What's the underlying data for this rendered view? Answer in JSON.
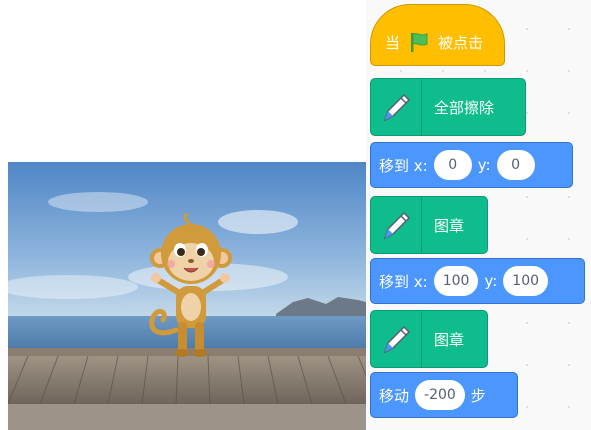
{
  "code": {
    "event_when": "当",
    "event_clicked": "被点击",
    "erase_all": "全部擦除",
    "goto1_label": "移到 x:",
    "goto1_x": "0",
    "goto1_ylabel": "y:",
    "goto1_y": "0",
    "stamp1": "图章",
    "goto2_label": "移到 x:",
    "goto2_x": "100",
    "goto2_ylabel": "y:",
    "goto2_y": "100",
    "stamp2": "图章",
    "move_label": "移动",
    "move_steps": "-200",
    "move_unit": "步"
  },
  "colors": {
    "motion": "#4c97ff",
    "pen": "#0fbd8c",
    "events": "#ffbf00",
    "flag": "#4cbf56"
  },
  "icons": {
    "pen": "pen-icon",
    "flag": "green-flag-icon",
    "sprite": "monkey-sprite"
  }
}
